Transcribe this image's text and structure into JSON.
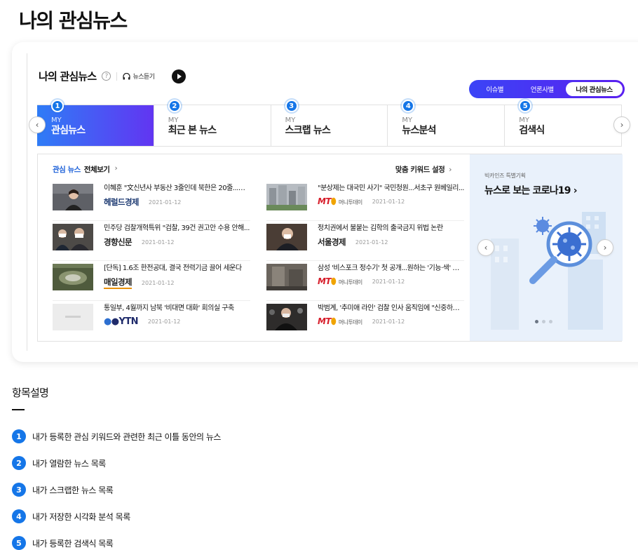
{
  "page": {
    "title": "나의 관심뉴스"
  },
  "widget": {
    "title": "나의 관심뉴스",
    "help_icon": "?",
    "headphone_icon": "headphone-icon",
    "listen_label": "뉴스듣기",
    "segments": [
      "이슈별",
      "언론사별",
      "나의 관심뉴스"
    ],
    "active_segment": "나의 관심뉴스",
    "tabs": [
      {
        "num": "1",
        "my": "MY",
        "label": "관심뉴스"
      },
      {
        "num": "2",
        "my": "MY",
        "label": "최근 본 뉴스"
      },
      {
        "num": "3",
        "my": "MY",
        "label": "스크랩 뉴스"
      },
      {
        "num": "4",
        "my": "MY",
        "label": "뉴스분석"
      },
      {
        "num": "5",
        "my": "MY",
        "label": "검색식"
      }
    ],
    "prev_arrow": "‹",
    "next_arrow": "›"
  },
  "news": {
    "head_blue": "관심 뉴스",
    "head_dark": "전체보기",
    "head_chevron": "›",
    "keyword_setting": "맞춤 키워드 설정",
    "left": [
      {
        "title": "이혜훈 \"文신년사 부동산 3줄인데 북한은 20줄...속 ...",
        "press": "헤럴드경제",
        "date": "2021-01-12"
      },
      {
        "title": "민주당 검찰개혁특위 \"검찰, 39건 권고안 수용 안해...",
        "press": "경향신문",
        "date": "2021-01-12"
      },
      {
        "title": "[단독] 1.6조 한전공대, 결국 전력기금 끌어 세운다",
        "press": "매일경제",
        "date": "2021-01-12"
      },
      {
        "title": "통일부, 4월까지 남북 '비대면 대화' 회의실 구축",
        "press": "YTN",
        "date": "2021-01-12"
      }
    ],
    "right": [
      {
        "title": "\"분상제는 대국민 사기\" 국민청원...서초구 원베일리...",
        "press": "MT",
        "press_sub": "머니투데이",
        "date": "2021-01-12"
      },
      {
        "title": "정치권에서 불붙는 김학의 출국금지 위법 논란",
        "press": "서울경제",
        "date": "2021-01-12"
      },
      {
        "title": "삼성 '비스포크 정수기' 첫 공개...원하는 '기능·색' 맞...",
        "press": "MT",
        "press_sub": "머니투데이",
        "date": "2021-01-12"
      },
      {
        "title": "박범계, '추미애 라인' 검찰 인사 움직임에 \"신중하라...",
        "press": "MT",
        "press_sub": "머니투데이",
        "date": "2021-01-12"
      }
    ]
  },
  "banner": {
    "kicker": "빅카인즈 특별기획",
    "title": "뉴스로 보는 코로나19",
    "title_chevron": "›",
    "slide_count": 3,
    "active_slide": 1
  },
  "description": {
    "title": "항목설명",
    "items": [
      {
        "num": "1",
        "text": "내가 등록한 관심 키워드와 관련한 최근 이틀 동안의 뉴스"
      },
      {
        "num": "2",
        "text": "내가 열람한 뉴스 목록"
      },
      {
        "num": "3",
        "text": "내가 스크랩한 뉴스 목록"
      },
      {
        "num": "4",
        "text": "내가 저장한 시각화 분석 목록"
      },
      {
        "num": "5",
        "text": "내가 등록한 검색식 목록"
      }
    ]
  },
  "colors": {
    "accent": "#1576e8",
    "tab_gradient_start": "#2f7cf6",
    "tab_gradient_end": "#6235f2",
    "banner_bg": "#e9f1fb"
  }
}
